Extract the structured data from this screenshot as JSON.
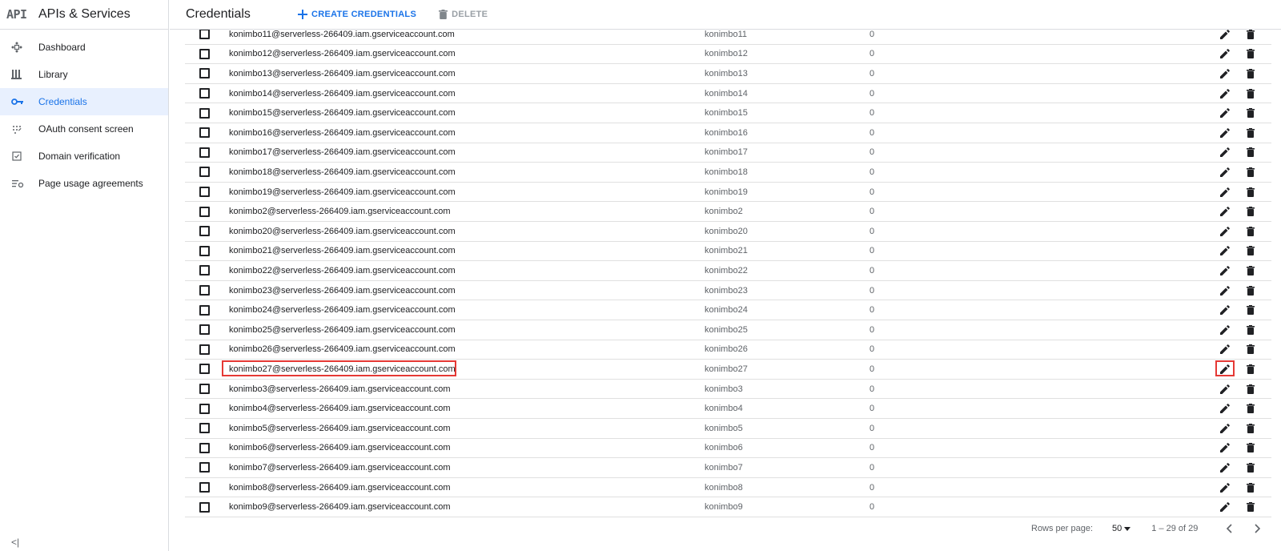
{
  "app": {
    "logo": "API",
    "title": "APIs & Services"
  },
  "sidebar": {
    "items": [
      {
        "label": "Dashboard",
        "icon": "dashboard-icon",
        "active": false
      },
      {
        "label": "Library",
        "icon": "library-icon",
        "active": false
      },
      {
        "label": "Credentials",
        "icon": "key-icon",
        "active": true
      },
      {
        "label": "OAuth consent screen",
        "icon": "consent-icon",
        "active": false
      },
      {
        "label": "Domain verification",
        "icon": "checkbox-icon",
        "active": false
      },
      {
        "label": "Page usage agreements",
        "icon": "settings-list-icon",
        "active": false
      }
    ],
    "collapse_label": "<|"
  },
  "header": {
    "title": "Credentials",
    "create_label": "CREATE CREDENTIALS",
    "delete_label": "DELETE"
  },
  "table": {
    "rows": [
      {
        "email": "konimbo11@serverless-266409.iam.gserviceaccount.com",
        "name": "konimbo11",
        "count": "0"
      },
      {
        "email": "konimbo12@serverless-266409.iam.gserviceaccount.com",
        "name": "konimbo12",
        "count": "0"
      },
      {
        "email": "konimbo13@serverless-266409.iam.gserviceaccount.com",
        "name": "konimbo13",
        "count": "0"
      },
      {
        "email": "konimbo14@serverless-266409.iam.gserviceaccount.com",
        "name": "konimbo14",
        "count": "0"
      },
      {
        "email": "konimbo15@serverless-266409.iam.gserviceaccount.com",
        "name": "konimbo15",
        "count": "0"
      },
      {
        "email": "konimbo16@serverless-266409.iam.gserviceaccount.com",
        "name": "konimbo16",
        "count": "0"
      },
      {
        "email": "konimbo17@serverless-266409.iam.gserviceaccount.com",
        "name": "konimbo17",
        "count": "0"
      },
      {
        "email": "konimbo18@serverless-266409.iam.gserviceaccount.com",
        "name": "konimbo18",
        "count": "0"
      },
      {
        "email": "konimbo19@serverless-266409.iam.gserviceaccount.com",
        "name": "konimbo19",
        "count": "0"
      },
      {
        "email": "konimbo2@serverless-266409.iam.gserviceaccount.com",
        "name": "konimbo2",
        "count": "0"
      },
      {
        "email": "konimbo20@serverless-266409.iam.gserviceaccount.com",
        "name": "konimbo20",
        "count": "0"
      },
      {
        "email": "konimbo21@serverless-266409.iam.gserviceaccount.com",
        "name": "konimbo21",
        "count": "0"
      },
      {
        "email": "konimbo22@serverless-266409.iam.gserviceaccount.com",
        "name": "konimbo22",
        "count": "0"
      },
      {
        "email": "konimbo23@serverless-266409.iam.gserviceaccount.com",
        "name": "konimbo23",
        "count": "0"
      },
      {
        "email": "konimbo24@serverless-266409.iam.gserviceaccount.com",
        "name": "konimbo24",
        "count": "0"
      },
      {
        "email": "konimbo25@serverless-266409.iam.gserviceaccount.com",
        "name": "konimbo25",
        "count": "0"
      },
      {
        "email": "konimbo26@serverless-266409.iam.gserviceaccount.com",
        "name": "konimbo26",
        "count": "0"
      },
      {
        "email": "konimbo27@serverless-266409.iam.gserviceaccount.com",
        "name": "konimbo27",
        "count": "0",
        "highlighted": true
      },
      {
        "email": "konimbo3@serverless-266409.iam.gserviceaccount.com",
        "name": "konimbo3",
        "count": "0"
      },
      {
        "email": "konimbo4@serverless-266409.iam.gserviceaccount.com",
        "name": "konimbo4",
        "count": "0"
      },
      {
        "email": "konimbo5@serverless-266409.iam.gserviceaccount.com",
        "name": "konimbo5",
        "count": "0"
      },
      {
        "email": "konimbo6@serverless-266409.iam.gserviceaccount.com",
        "name": "konimbo6",
        "count": "0"
      },
      {
        "email": "konimbo7@serverless-266409.iam.gserviceaccount.com",
        "name": "konimbo7",
        "count": "0"
      },
      {
        "email": "konimbo8@serverless-266409.iam.gserviceaccount.com",
        "name": "konimbo8",
        "count": "0"
      },
      {
        "email": "konimbo9@serverless-266409.iam.gserviceaccount.com",
        "name": "konimbo9",
        "count": "0"
      }
    ],
    "edit_icon": "pencil-icon",
    "delete_icon": "trash-icon",
    "highlight_color": "#e53935"
  },
  "pagination": {
    "rows_per_page_label": "Rows per page:",
    "rows_per_page_value": "50",
    "range": "1 – 29 of 29"
  },
  "colors": {
    "accent": "#1a73e8",
    "active_bg": "#e8f0fe"
  }
}
